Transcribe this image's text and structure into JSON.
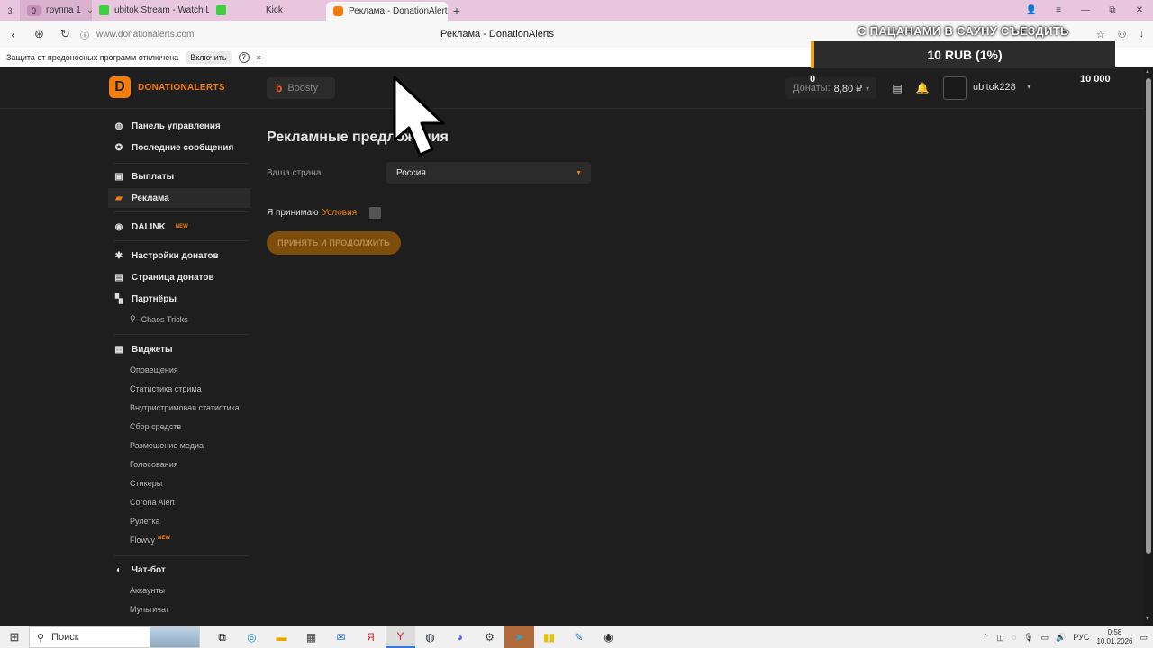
{
  "browser": {
    "tab_count": "3",
    "group_label": "группа 1",
    "tabs": [
      {
        "title": "ubitok Stream - Watch Live",
        "active": false
      },
      {
        "title": "Kick",
        "active": false
      },
      {
        "title": "Реклама - DonationAlerts",
        "active": true
      }
    ],
    "url": "www.donationalerts.com",
    "page_title": "Реклама - DonationAlerts"
  },
  "protection_bar": {
    "message": "Защита от предоносных программ отключена",
    "enable_label": "Включить",
    "help": "?",
    "close": "×"
  },
  "overlay": {
    "ticker_text": "С ПАЦАНАМИ В САУНУ СЪЕЗДИТЬ",
    "goal_text": "10 RUB (1%)",
    "goal_min": "0",
    "goal_max": "10 000",
    "goal_progress_percent": 1
  },
  "header": {
    "brand": "DONATIONALERTS",
    "boosty_label": "Boosty",
    "donates_label": "Донаты:",
    "donates_value": "8,80 ₽",
    "username": "ubitok228"
  },
  "sidebar": {
    "items": [
      {
        "label": "Панель управления",
        "icon": "dashboard-icon"
      },
      {
        "label": "Последние сообщения",
        "icon": "star-icon"
      },
      {
        "label": "Выплаты",
        "icon": "wallet-icon"
      },
      {
        "label": "Реклама",
        "icon": "ads-icon"
      },
      {
        "label": "DALINK",
        "icon": "dalink-icon",
        "badge": "NEW"
      },
      {
        "label": "Настройки донатов",
        "icon": "gear-icon"
      },
      {
        "label": "Страница донатов",
        "icon": "page-icon"
      },
      {
        "label": "Партнёры",
        "icon": "partners-icon"
      },
      {
        "label": "Виджеты",
        "icon": "widgets-icon"
      },
      {
        "label": "Чат-бот",
        "icon": "chat-icon"
      }
    ],
    "partner_sub": "Chaos Tricks",
    "widget_subs": [
      "Оповещения",
      "Статистика стрима",
      "Внутристримовая статистика",
      "Сбор средств",
      "Размещение медиа",
      "Голосования",
      "Стикеры",
      "Corona Alert",
      "Рулетка",
      "Flowvy"
    ],
    "flowvy_badge": "NEW",
    "chatbot_subs": [
      "Аккаунты",
      "Мультичат"
    ]
  },
  "main": {
    "title": "Рекламные предложения",
    "country_label": "Ваша страна",
    "country_value": "Россия",
    "accept_prefix": "Я принимаю",
    "terms_link": "Условия",
    "accept_button": "ПРИНЯТЬ И ПРОДОЛЖИТЬ"
  },
  "taskbar": {
    "search_placeholder": "Поиск",
    "lang": "РУС",
    "time": "0:58",
    "date": "10.01.2026"
  },
  "colors": {
    "accent": "#f57d07",
    "background": "#1e1e1e",
    "tabstrip": "#e8c6e0"
  }
}
